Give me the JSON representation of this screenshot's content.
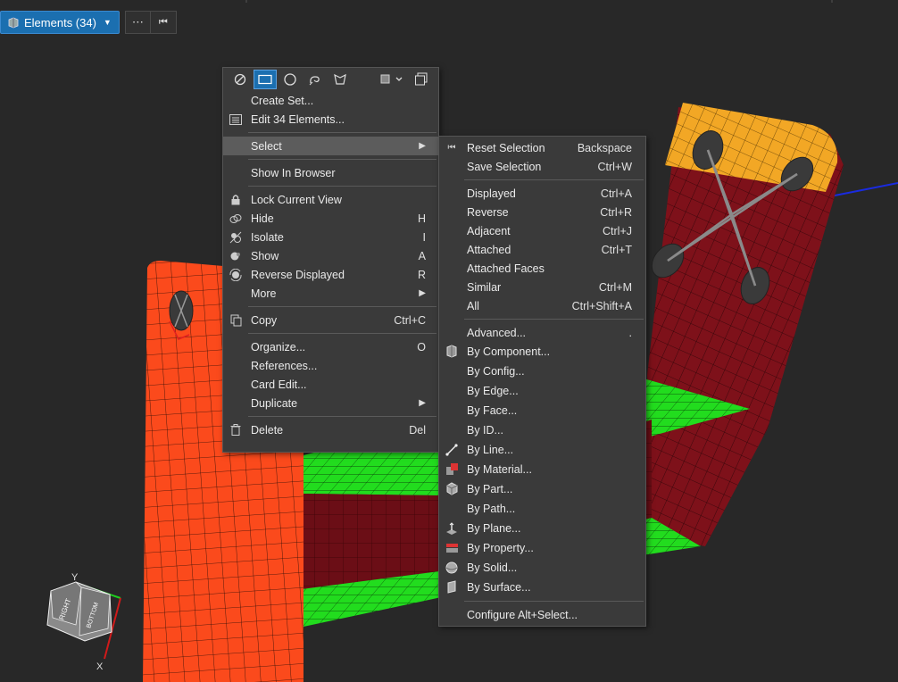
{
  "toolbar": {
    "selection_label": "Elements (34)",
    "more_label": "⋯",
    "reset_label": "⏮"
  },
  "context_menu": {
    "items": [
      {
        "label": "Create Set...",
        "shortcut": ""
      },
      {
        "label": "Edit 34 Elements...",
        "shortcut": ""
      },
      {
        "label": "Select",
        "shortcut": ""
      },
      {
        "label": "Show In Browser",
        "shortcut": ""
      },
      {
        "label": "Lock Current View",
        "shortcut": ""
      },
      {
        "label": "Hide",
        "shortcut": "H"
      },
      {
        "label": "Isolate",
        "shortcut": "I"
      },
      {
        "label": "Show",
        "shortcut": "A"
      },
      {
        "label": "Reverse Displayed",
        "shortcut": "R"
      },
      {
        "label": "More",
        "shortcut": ""
      },
      {
        "label": "Copy",
        "shortcut": "Ctrl+C"
      },
      {
        "label": "Organize...",
        "shortcut": "O"
      },
      {
        "label": "References...",
        "shortcut": ""
      },
      {
        "label": "Card Edit...",
        "shortcut": ""
      },
      {
        "label": "Duplicate",
        "shortcut": ""
      },
      {
        "label": "Delete",
        "shortcut": "Del"
      }
    ]
  },
  "select_submenu": {
    "items": [
      {
        "label": "Reset Selection",
        "shortcut": "Backspace"
      },
      {
        "label": "Save Selection",
        "shortcut": "Ctrl+W"
      },
      {
        "label": "Displayed",
        "shortcut": "Ctrl+A"
      },
      {
        "label": "Reverse",
        "shortcut": "Ctrl+R"
      },
      {
        "label": "Adjacent",
        "shortcut": "Ctrl+J"
      },
      {
        "label": "Attached",
        "shortcut": "Ctrl+T"
      },
      {
        "label": "Attached Faces",
        "shortcut": ""
      },
      {
        "label": "Similar",
        "shortcut": "Ctrl+M"
      },
      {
        "label": "All",
        "shortcut": "Ctrl+Shift+A"
      },
      {
        "label": "Advanced...",
        "shortcut": "."
      },
      {
        "label": "By Component...",
        "shortcut": ""
      },
      {
        "label": "By Config...",
        "shortcut": ""
      },
      {
        "label": "By Edge...",
        "shortcut": ""
      },
      {
        "label": "By Face...",
        "shortcut": ""
      },
      {
        "label": "By ID...",
        "shortcut": ""
      },
      {
        "label": "By Line...",
        "shortcut": ""
      },
      {
        "label": "By Material...",
        "shortcut": ""
      },
      {
        "label": "By Part...",
        "shortcut": ""
      },
      {
        "label": "By Path...",
        "shortcut": ""
      },
      {
        "label": "By Plane...",
        "shortcut": ""
      },
      {
        "label": "By Property...",
        "shortcut": ""
      },
      {
        "label": "By Solid...",
        "shortcut": ""
      },
      {
        "label": "By Surface...",
        "shortcut": ""
      },
      {
        "label": "Configure Alt+Select...",
        "shortcut": ""
      }
    ]
  },
  "nav_cube": {
    "face_front": "RIGHT",
    "face_side": "BOTTOM",
    "axis_y": "Y",
    "axis_x": "X"
  },
  "colors": {
    "background": "#282828",
    "menu_bg": "#3a3a3a",
    "highlight": "#5c5c5c",
    "accent": "#1b6fb0",
    "mesh_orange": "#fb4a1c",
    "mesh_darkred": "#7e111a",
    "mesh_yellow": "#f2a725",
    "mesh_green": "#22dc1e"
  }
}
